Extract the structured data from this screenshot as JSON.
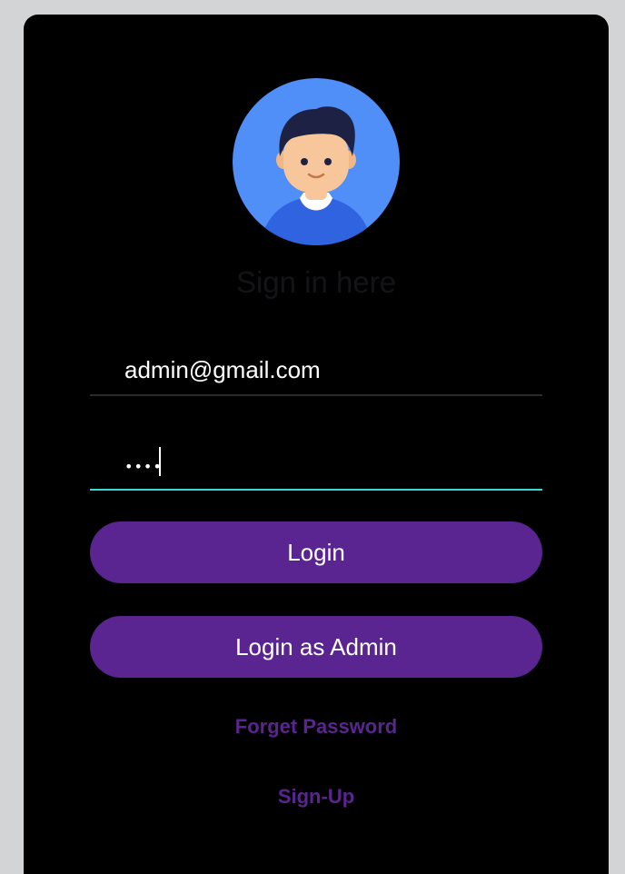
{
  "form": {
    "heading": "Sign in here",
    "email_value": "admin@gmail.com",
    "password_masked": "••••"
  },
  "buttons": {
    "login_label": "Login",
    "login_admin_label": "Login as Admin"
  },
  "links": {
    "forget_password": "Forget Password",
    "sign_up": "Sign-Up"
  },
  "colors": {
    "page_bg": "#d3d4d6",
    "card_bg": "#000000",
    "button_bg": "#5a2590",
    "link_color": "#5a2590",
    "focus_underline": "#3dd6d0",
    "avatar_bg": "#4f8ff7"
  },
  "icons": {
    "avatar": "user-avatar-icon"
  }
}
